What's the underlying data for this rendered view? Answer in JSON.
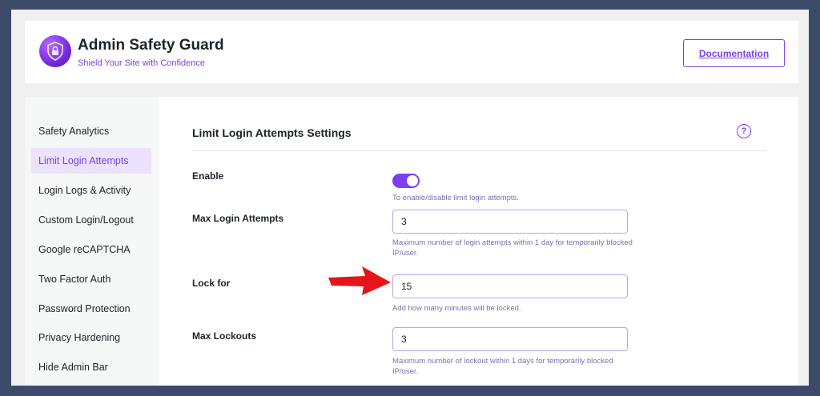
{
  "header": {
    "title": "Admin Safety Guard",
    "subtitle": "Shield Your Site with Confidence",
    "documentation_label": "Documentation",
    "logo_icon": "shield-lock-icon"
  },
  "sidebar": {
    "items": [
      {
        "label": "Safety Analytics",
        "active": false
      },
      {
        "label": "Limit Login Attempts",
        "active": true
      },
      {
        "label": "Login Logs & Activity",
        "active": false
      },
      {
        "label": "Custom Login/Logout",
        "active": false
      },
      {
        "label": "Google reCAPTCHA",
        "active": false
      },
      {
        "label": "Two Factor Auth",
        "active": false
      },
      {
        "label": "Password Protection",
        "active": false
      },
      {
        "label": "Privacy Hardening",
        "active": false
      },
      {
        "label": "Hide Admin Bar",
        "active": false
      }
    ]
  },
  "main": {
    "title": "Limit Login Attempts Settings",
    "help_icon": "?",
    "fields": {
      "enable": {
        "label": "Enable",
        "enabled": true,
        "help": "To enable/disable limit login attempts."
      },
      "max_login_attempts": {
        "label": "Max Login Attempts",
        "value": "3",
        "help": "Maximum number of login attempts within 1 day for temporarily blocked IP/user."
      },
      "lock_for": {
        "label": "Lock for",
        "value": "15",
        "help": "Add how many minutes will be locked."
      },
      "max_lockouts": {
        "label": "Max Lockouts",
        "value": "3",
        "help": "Maximum number of lockout within 1 days for temporarily blocked IP/user."
      }
    }
  },
  "colors": {
    "accent": "#7b3ff2",
    "background": "#3d4b6b",
    "arrow": "#e8141b"
  }
}
